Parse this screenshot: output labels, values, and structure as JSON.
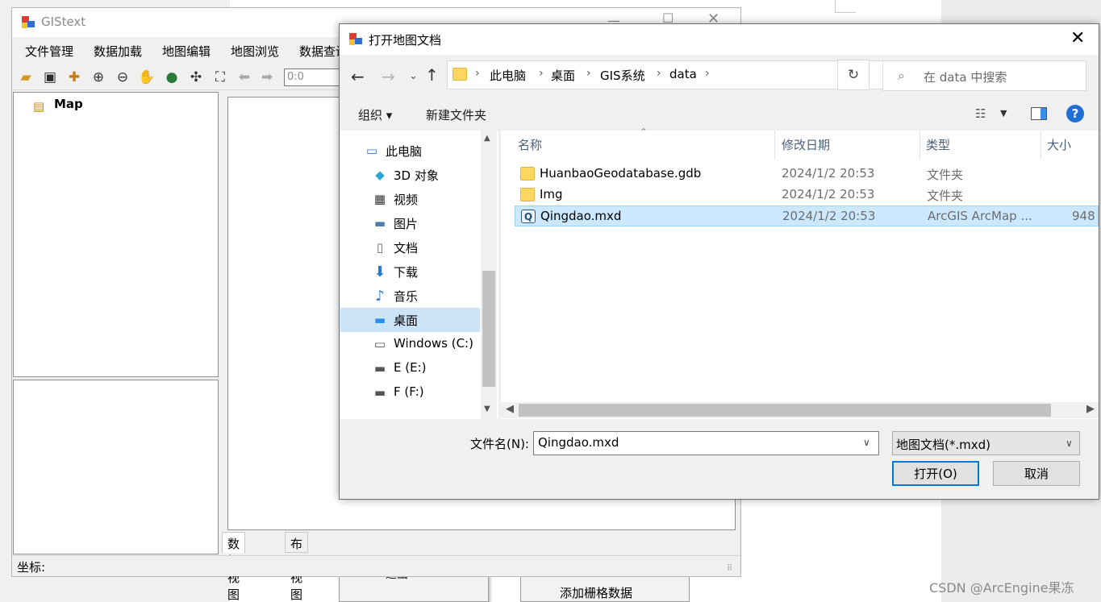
{
  "app": {
    "title": "GIStext",
    "menu": [
      "文件管理",
      "数据加载",
      "地图编辑",
      "地图浏览",
      "数据查询"
    ],
    "scale_value": "0:0",
    "toc_root": "Map",
    "view_tabs": [
      "数据视图",
      "布局视图"
    ],
    "status_label": "坐标:"
  },
  "dialog": {
    "title": "打开地图文档",
    "breadcrumbs": [
      "此电脑",
      "桌面",
      "GIS系统",
      "data"
    ],
    "search_placeholder": "在 data 中搜索",
    "organize_label": "组织 ▾",
    "new_folder_label": "新建文件夹",
    "nav_items": [
      {
        "label": "此电脑",
        "icon": "computer-icon"
      },
      {
        "label": "3D 对象",
        "icon": "3d-objects-icon"
      },
      {
        "label": "视频",
        "icon": "video-icon"
      },
      {
        "label": "图片",
        "icon": "pictures-icon"
      },
      {
        "label": "文档",
        "icon": "documents-icon"
      },
      {
        "label": "下载",
        "icon": "download-icon"
      },
      {
        "label": "音乐",
        "icon": "music-icon"
      },
      {
        "label": "桌面",
        "icon": "desktop-icon"
      },
      {
        "label": "Windows (C:)",
        "icon": "system-drive-icon"
      },
      {
        "label": "E (E:)",
        "icon": "drive-icon"
      },
      {
        "label": "F (F:)",
        "icon": "drive-icon"
      }
    ],
    "selected_nav": "桌面",
    "columns": [
      "名称",
      "修改日期",
      "类型",
      "大小"
    ],
    "files": [
      {
        "name": "HuanbaoGeodatabase.gdb",
        "date": "2024/1/2 20:53",
        "type": "文件夹",
        "size": "",
        "icon": "folder-icon"
      },
      {
        "name": "Img",
        "date": "2024/1/2 20:53",
        "type": "文件夹",
        "size": "",
        "icon": "folder-icon"
      },
      {
        "name": "Qingdao.mxd",
        "date": "2024/1/2 20:53",
        "type": "ArcGIS ArcMap ...",
        "size": "948",
        "icon": "mxd-file-icon"
      }
    ],
    "selected_file": "Qingdao.mxd",
    "filename_label": "文件名(N):",
    "filename_value": "Qingdao.mxd",
    "filter_value": "地图文档(*.mxd)",
    "open_label": "打开(O)",
    "cancel_label": "取消"
  },
  "background": {
    "menu_item_1": "退出",
    "menu_item_2": "添加栅格数据"
  },
  "watermark": "CSDN @ArcEngine果冻",
  "colors": {
    "selection": "#cce8ff",
    "nav_selection": "#cce4f7",
    "primary_button_border": "#0078d7",
    "help_blue": "#1f6fd6",
    "folder_yellow": "#ffd760"
  }
}
